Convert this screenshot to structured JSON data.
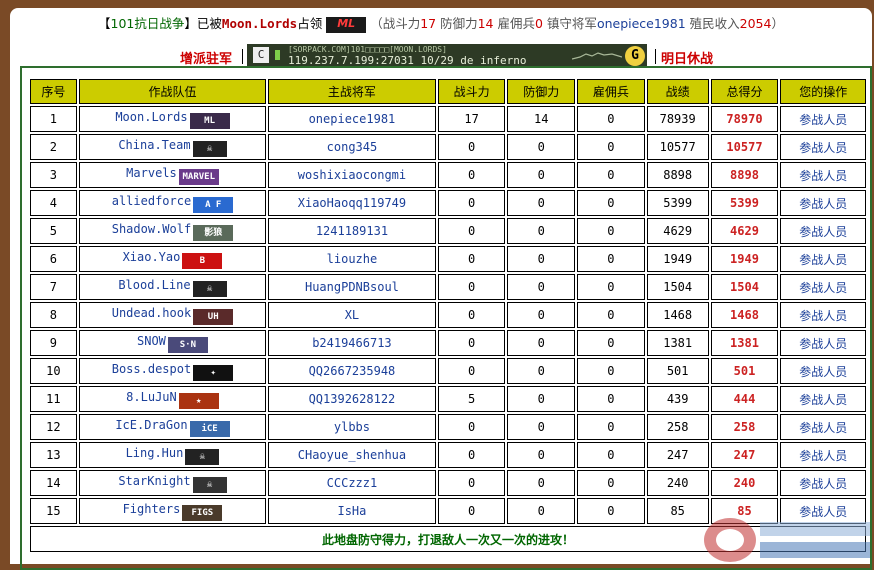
{
  "header": {
    "bracket_open": "【",
    "war_name": "101抗日战争",
    "bracket_close": "】",
    "occupied_by": "已被",
    "clan": "Moon.Lords",
    "occupied_suffix": "占领",
    "stats_open": "（战斗力",
    "attack_value": "17",
    "defense_label": " 防御力",
    "defense_value": "14",
    "mercenary_label": " 雇佣兵",
    "mercenary_value": "0",
    "general_label": " 镇守将军",
    "general_name": "onepiece1981",
    "income_label": " 殖民收入",
    "income_value": "2054",
    "stats_close": "）"
  },
  "subbar": {
    "left_link": "增派驻军",
    "right_link": "明日休战",
    "server_small": "[SORPACK.COM]101□□□□□[MOON.LORDS]",
    "server_ip": "119.237.7.199:27031",
    "server_players": "10/29",
    "server_map": "de_inferno",
    "server_badge": "C"
  },
  "table": {
    "headers": [
      "序号",
      "作战队伍",
      "主战将军",
      "战斗力",
      "防御力",
      "雇佣兵",
      "战绩",
      "总得分",
      "您的操作"
    ],
    "action_label": "参战人员",
    "rows": [
      {
        "rank": "1",
        "team": "Moon.Lords",
        "logo": "ML",
        "logo_color": "#3a2a4a",
        "general": "onepiece1981",
        "attack": "17",
        "defense": "14",
        "merc": "0",
        "record": "78939",
        "score": "78970"
      },
      {
        "rank": "2",
        "team": "China.Team",
        "logo": "☠",
        "logo_color": "#222222",
        "general": "cong345",
        "attack": "0",
        "defense": "0",
        "merc": "0",
        "record": "10577",
        "score": "10577"
      },
      {
        "rank": "3",
        "team": "Marvels",
        "logo": "MARVEL",
        "logo_color": "#6a3a8a",
        "general": "woshixiaocongmi",
        "attack": "0",
        "defense": "0",
        "merc": "0",
        "record": "8898",
        "score": "8898"
      },
      {
        "rank": "4",
        "team": "alliedforce",
        "logo": "A F",
        "logo_color": "#2a6ad0",
        "general": "XiaoHaoqq119749",
        "attack": "0",
        "defense": "0",
        "merc": "0",
        "record": "5399",
        "score": "5399"
      },
      {
        "rank": "5",
        "team": "Shadow.Wolf",
        "logo": "影狼",
        "logo_color": "#5a6a5a",
        "general": "1241189131",
        "attack": "0",
        "defense": "0",
        "merc": "0",
        "record": "4629",
        "score": "4629"
      },
      {
        "rank": "6",
        "team": "Xiao.Yao",
        "logo": "B",
        "logo_color": "#cc1111",
        "general": "liouzhe",
        "attack": "0",
        "defense": "0",
        "merc": "0",
        "record": "1949",
        "score": "1949"
      },
      {
        "rank": "7",
        "team": "Blood.Line",
        "logo": "☠",
        "logo_color": "#222222",
        "general": "HuangPDNBsoul",
        "attack": "0",
        "defense": "0",
        "merc": "0",
        "record": "1504",
        "score": "1504"
      },
      {
        "rank": "8",
        "team": "Undead.hook",
        "logo": "UH",
        "logo_color": "#5a2a2a",
        "general": "XL",
        "attack": "0",
        "defense": "0",
        "merc": "0",
        "record": "1468",
        "score": "1468"
      },
      {
        "rank": "9",
        "team": "SNOW",
        "logo": "S·N",
        "logo_color": "#4a4a7a",
        "general": "b2419466713",
        "attack": "0",
        "defense": "0",
        "merc": "0",
        "record": "1381",
        "score": "1381"
      },
      {
        "rank": "10",
        "team": "Boss.despot",
        "logo": "✦",
        "logo_color": "#111111",
        "general": "QQ2667235948",
        "attack": "0",
        "defense": "0",
        "merc": "0",
        "record": "501",
        "score": "501"
      },
      {
        "rank": "11",
        "team": "8.LuJuN",
        "logo": "★",
        "logo_color": "#aa3311",
        "general": "QQ1392628122",
        "attack": "5",
        "defense": "0",
        "merc": "0",
        "record": "439",
        "score": "444"
      },
      {
        "rank": "12",
        "team": "IcE.DraGon",
        "logo": "iCE",
        "logo_color": "#3a6aaa",
        "general": "ylbbs",
        "attack": "0",
        "defense": "0",
        "merc": "0",
        "record": "258",
        "score": "258"
      },
      {
        "rank": "13",
        "team": "Ling.Hun",
        "logo": "☠",
        "logo_color": "#222222",
        "general": "CHaoyue_shenhua",
        "attack": "0",
        "defense": "0",
        "merc": "0",
        "record": "247",
        "score": "247"
      },
      {
        "rank": "14",
        "team": "StarKnight",
        "logo": "☠",
        "logo_color": "#333333",
        "general": "CCCzzz1",
        "attack": "0",
        "defense": "0",
        "merc": "0",
        "record": "240",
        "score": "240"
      },
      {
        "rank": "15",
        "team": "Fighters",
        "logo": "FIGS",
        "logo_color": "#4a3a2a",
        "general": "IsHa",
        "attack": "0",
        "defense": "0",
        "merc": "0",
        "record": "85",
        "score": "85"
      }
    ],
    "footer": "此地盘防守得力，打退敌人一次又一次的进攻！"
  },
  "colors": {
    "background": "#7a4a26",
    "header_cell": "#cccc00",
    "score": "#cc2222",
    "link": "#1b3f99",
    "footer_text": "#006600",
    "table_border": "#2e6e2e"
  }
}
